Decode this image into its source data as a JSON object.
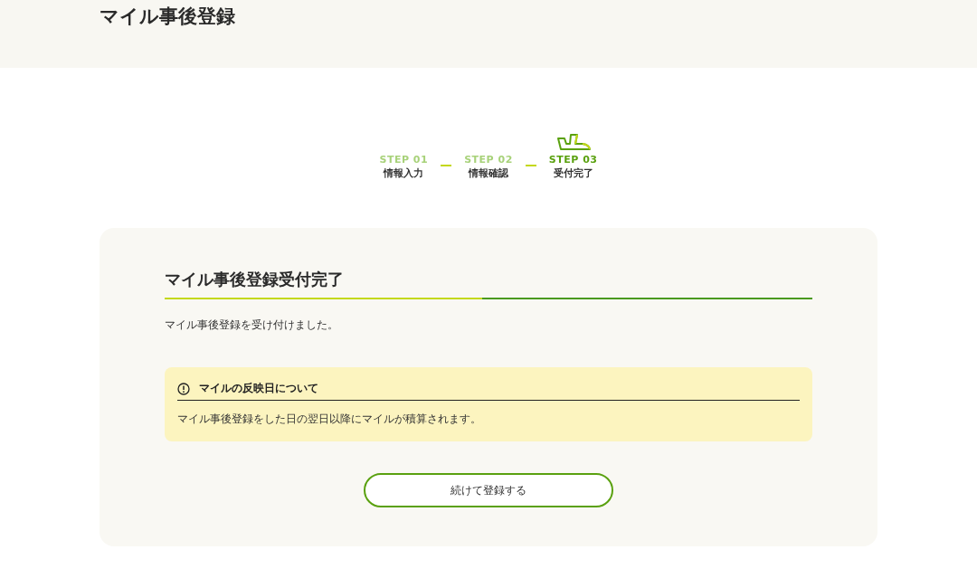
{
  "page_title": "マイル事後登録",
  "steps": [
    {
      "label": "STEP 01",
      "name": "情報入力",
      "selected": false
    },
    {
      "label": "STEP 02",
      "name": "情報確認",
      "selected": false
    },
    {
      "label": "STEP 03",
      "name": "受付完了",
      "selected": true
    }
  ],
  "card": {
    "heading": "マイル事後登録受付完了",
    "message": "マイル事後登録を受け付けました。",
    "notice": {
      "title": "マイルの反映日について",
      "body": "マイル事後登録をした日の翌日以降にマイルが積算されます。"
    },
    "button": "続けて登録する"
  }
}
